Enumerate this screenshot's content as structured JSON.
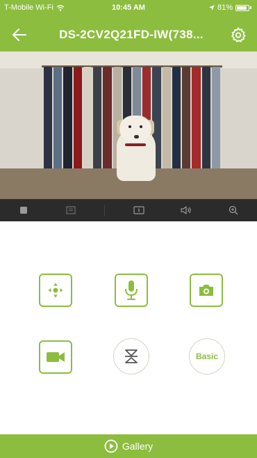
{
  "status_bar": {
    "carrier": "T-Mobile Wi-Fi",
    "time": "10:45 AM",
    "battery": "81%"
  },
  "nav": {
    "title": "DS-2CV2Q21FD-IW(738...",
    "back_icon": "arrow-left-icon",
    "settings_icon": "gear-icon"
  },
  "toolbar": {
    "items": [
      "stop-icon",
      "quality-icon",
      "fullscreen-icon",
      "speaker-icon",
      "zoom-in-icon"
    ]
  },
  "controls": {
    "ptz_icon": "ptz-direction-icon",
    "talk_icon": "microphone-icon",
    "capture_icon": "camera-icon",
    "record_icon": "video-camera-icon",
    "mirror_icon": "mirror-icon",
    "quality_label": "Basic"
  },
  "gallery": {
    "label": "Gallery",
    "icon": "play-circle-icon"
  },
  "colors": {
    "accent": "#8cbd3f",
    "toolbar_bg": "#2b2b2b"
  }
}
